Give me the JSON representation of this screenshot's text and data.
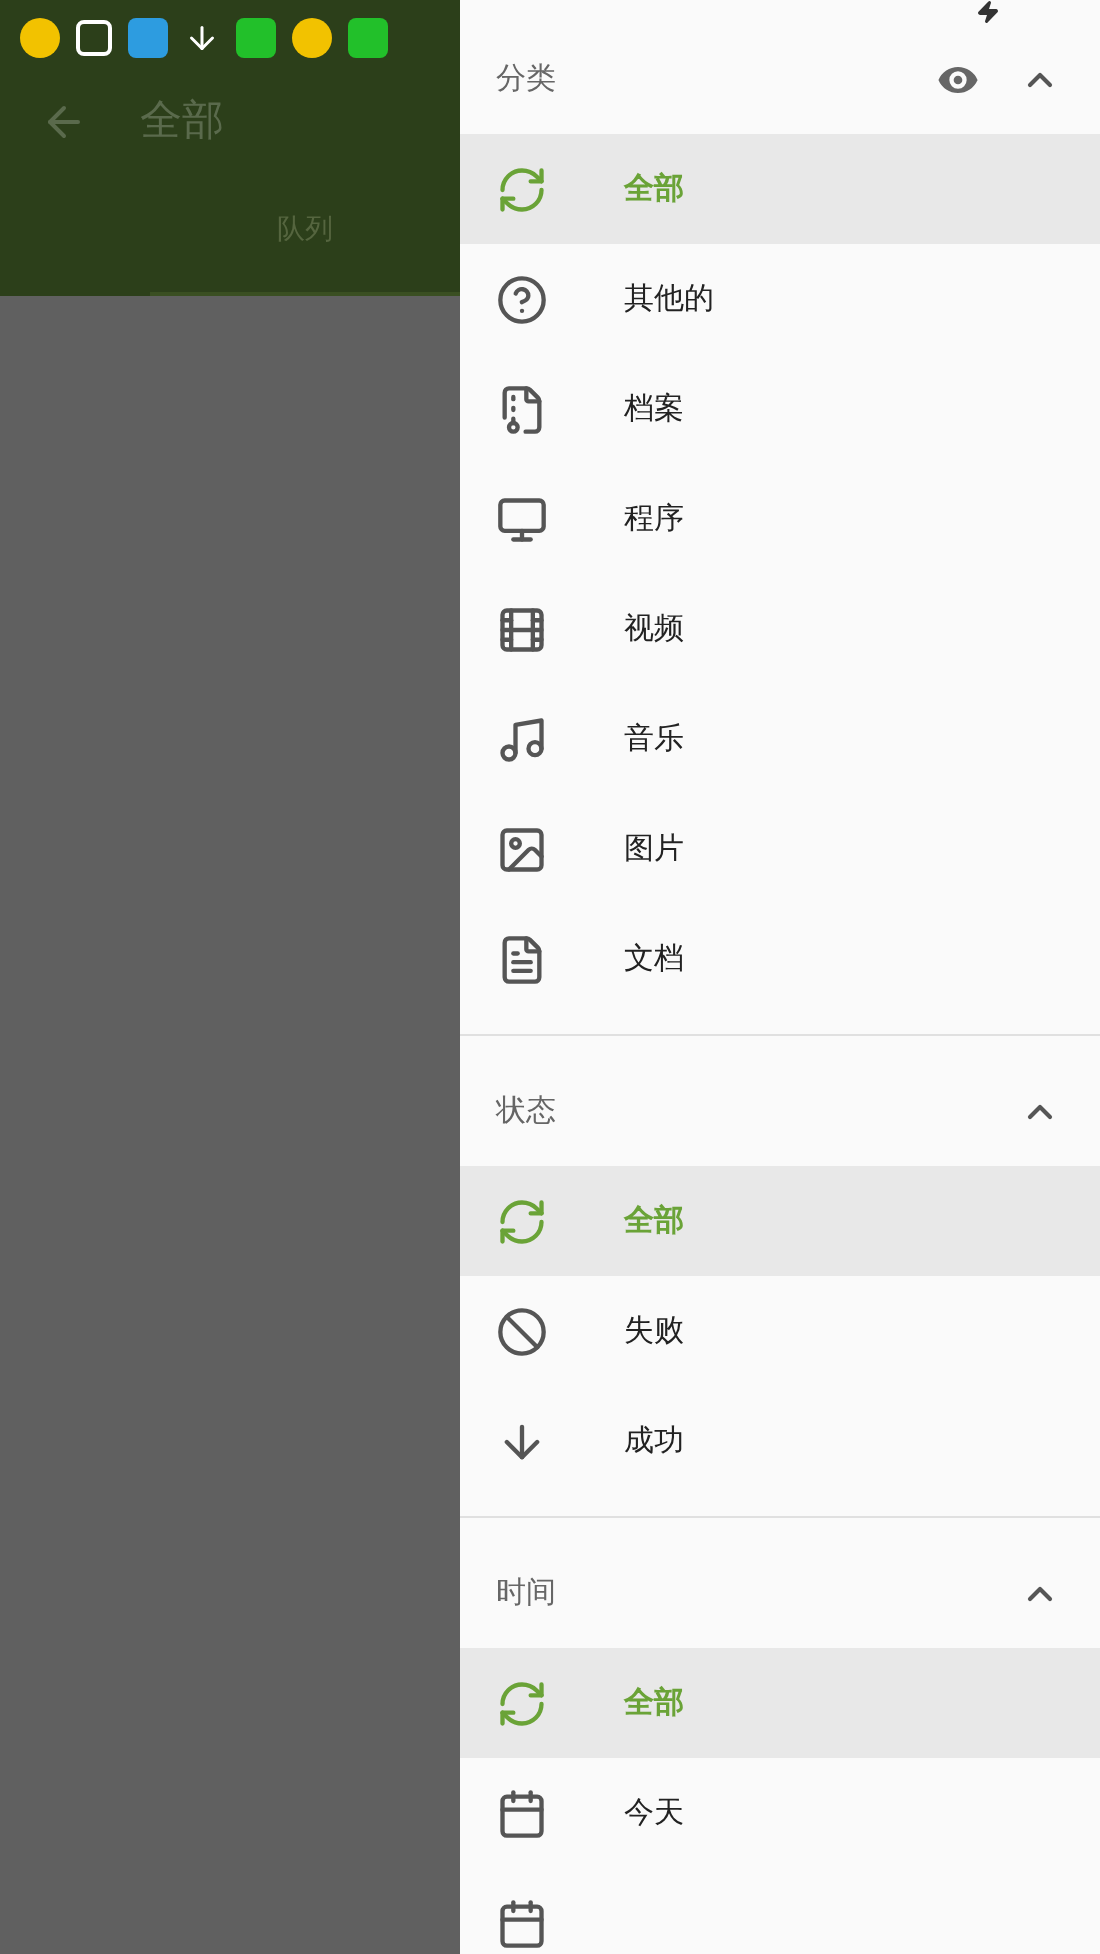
{
  "app_bar": {
    "title": "全部",
    "tabs": [
      {
        "label": "队列",
        "selected": true
      }
    ]
  },
  "drawer": {
    "sections": [
      {
        "title": "分类",
        "expanded": true,
        "show_visibility": true,
        "items": [
          {
            "kind": "sync",
            "label": "全部",
            "selected": true
          },
          {
            "kind": "help",
            "label": "其他的",
            "selected": false
          },
          {
            "kind": "archive",
            "label": "档案",
            "selected": false
          },
          {
            "kind": "monitor",
            "label": "程序",
            "selected": false
          },
          {
            "kind": "film",
            "label": "视频",
            "selected": false
          },
          {
            "kind": "music",
            "label": "音乐",
            "selected": false
          },
          {
            "kind": "image",
            "label": "图片",
            "selected": false
          },
          {
            "kind": "document",
            "label": "文档",
            "selected": false
          }
        ]
      },
      {
        "title": "状态",
        "expanded": true,
        "show_visibility": false,
        "items": [
          {
            "kind": "sync",
            "label": "全部",
            "selected": true
          },
          {
            "kind": "ban",
            "label": "失败",
            "selected": false
          },
          {
            "kind": "arrow-down",
            "label": "成功",
            "selected": false
          }
        ]
      },
      {
        "title": "时间",
        "expanded": true,
        "show_visibility": false,
        "items": [
          {
            "kind": "sync",
            "label": "全部",
            "selected": true
          },
          {
            "kind": "calendar",
            "label": "今天",
            "selected": false
          },
          {
            "kind": "calendar",
            "selected": false
          }
        ]
      }
    ]
  }
}
